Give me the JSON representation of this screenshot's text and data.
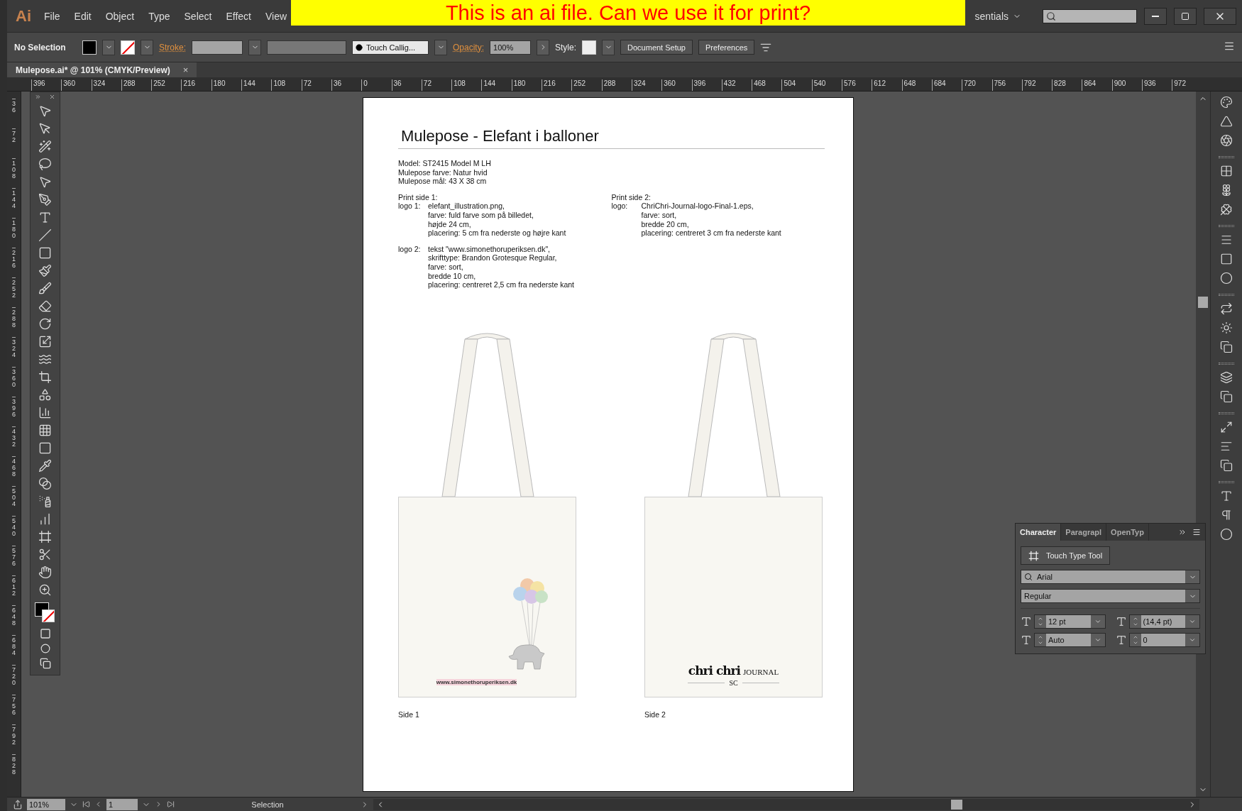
{
  "banner": {
    "text": "This is an ai file. Can we use it for print?"
  },
  "app_logo": "Ai",
  "menu": [
    "File",
    "Edit",
    "Object",
    "Type",
    "Select",
    "Effect",
    "View"
  ],
  "workspace": {
    "label": "sentials"
  },
  "control_bar": {
    "selection": "No Selection",
    "stroke_label": "Stroke:",
    "brush": "Touch Callig...",
    "opacity_label": "Opacity:",
    "opacity": "100%",
    "style_label": "Style:",
    "buttons": [
      "Document Setup",
      "Preferences"
    ]
  },
  "document_tab": {
    "title": "Mulepose.ai* @ 101% (CMYK/Preview)",
    "close": "×"
  },
  "ruler_h": [
    "396",
    "360",
    "324",
    "288",
    "252",
    "216",
    "180",
    "144",
    "108",
    "72",
    "36",
    "0",
    "36",
    "72",
    "108",
    "144",
    "180",
    "216",
    "252",
    "288",
    "324",
    "360",
    "396",
    "432",
    "468",
    "504",
    "540",
    "576",
    "612",
    "648",
    "684",
    "720",
    "756",
    "792",
    "828",
    "864",
    "900",
    "936",
    "972"
  ],
  "ruler_v": [
    "36",
    "72",
    "108",
    "144",
    "180",
    "216",
    "252",
    "288",
    "324",
    "360",
    "396",
    "432",
    "468",
    "504",
    "540",
    "576",
    "612",
    "648",
    "684",
    "720",
    "756",
    "792",
    "828"
  ],
  "artboard": {
    "title": "Mulepose - Elefant i balloner",
    "specs": [
      "Model: ST2415 Model M LH",
      "Mulepose farve: Natur hvid",
      "Mulepose mål: 43 X 38 cm"
    ],
    "print_sides": [
      {
        "heading": "Print side 1:",
        "logos": [
          {
            "label": "logo 1:",
            "lines": [
              "elefant_illustration.png,",
              "farve: fuld farve som på billedet,",
              "højde 24 cm,",
              "placering: 5 cm fra nederste og højre kant"
            ]
          },
          {
            "label": "logo 2:",
            "lines": [
              "tekst \"www.simonethoruperiksen.dk\",",
              "skrifttype: Brandon Grotesque Regular,",
              "farve: sort,",
              "bredde 10 cm,",
              "placering: centreret 2,5 cm fra nederste kant"
            ]
          }
        ]
      },
      {
        "heading": "Print side 2:",
        "logos": [
          {
            "label": "logo:",
            "lines": [
              "ChriChri-Journal-logo-Final-1.eps,",
              "farve: sort,",
              "bredde 20 cm,",
              "placering: centreret 3 cm fra nederste kant"
            ]
          }
        ]
      }
    ],
    "bags": [
      {
        "kind": "illustration",
        "caption": "Side 1",
        "url_text": "www.simonethoruperiksen.dk"
      },
      {
        "kind": "logo",
        "caption": "Side 2",
        "logo_name": "chri chri",
        "logo_word": "JOURNAL",
        "monogram": "SC"
      }
    ]
  },
  "character_panel": {
    "tabs": [
      {
        "label": "Character",
        "selected": true
      },
      {
        "label": "Paragrapl",
        "selected": false
      },
      {
        "label": "OpenTyp",
        "selected": false
      }
    ],
    "touch_type": "Touch Type Tool",
    "font": "Arial",
    "style": "Regular",
    "size": "12 pt",
    "leading": "(14,4 pt)",
    "kerning": "Auto",
    "tracking": "0"
  },
  "status_bar": {
    "zoom": "101%",
    "page": "1",
    "tool": "Selection"
  }
}
